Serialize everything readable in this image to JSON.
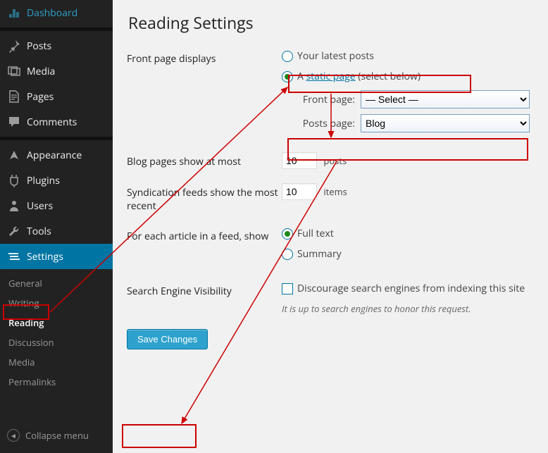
{
  "sidebar": {
    "items": [
      {
        "label": "Dashboard",
        "icon": "dashboard"
      },
      {
        "label": "Posts",
        "icon": "pin"
      },
      {
        "label": "Media",
        "icon": "media"
      },
      {
        "label": "Pages",
        "icon": "pages"
      },
      {
        "label": "Comments",
        "icon": "comments"
      },
      {
        "label": "Appearance",
        "icon": "appearance"
      },
      {
        "label": "Plugins",
        "icon": "plugins"
      },
      {
        "label": "Users",
        "icon": "users"
      },
      {
        "label": "Tools",
        "icon": "tools"
      },
      {
        "label": "Settings",
        "icon": "settings"
      }
    ],
    "submenu": [
      {
        "label": "General"
      },
      {
        "label": "Writing"
      },
      {
        "label": "Reading"
      },
      {
        "label": "Discussion"
      },
      {
        "label": "Media"
      },
      {
        "label": "Permalinks"
      }
    ],
    "collapse_label": "Collapse menu"
  },
  "page": {
    "title": "Reading Settings",
    "front_page_displays": {
      "label": "Front page displays",
      "opt_latest": "Your latest posts",
      "opt_static_prefix": "A ",
      "opt_static_link": "static page",
      "opt_static_suffix": " (select below)",
      "front_page_label": "Front page:",
      "front_page_value": "— Select —",
      "posts_page_label": "Posts page:",
      "posts_page_value": "Blog"
    },
    "blog_pages": {
      "label": "Blog pages show at most",
      "value": "10",
      "unit": "posts"
    },
    "syndication": {
      "label": "Syndication feeds show the most recent",
      "value": "10",
      "unit": "items"
    },
    "article_feed": {
      "label": "For each article in a feed, show",
      "full": "Full text",
      "summary": "Summary"
    },
    "search_engine": {
      "label": "Search Engine Visibility",
      "checkbox_label": "Discourage search engines from indexing this site",
      "desc": "It is up to search engines to honor this request."
    },
    "save_label": "Save Changes"
  }
}
